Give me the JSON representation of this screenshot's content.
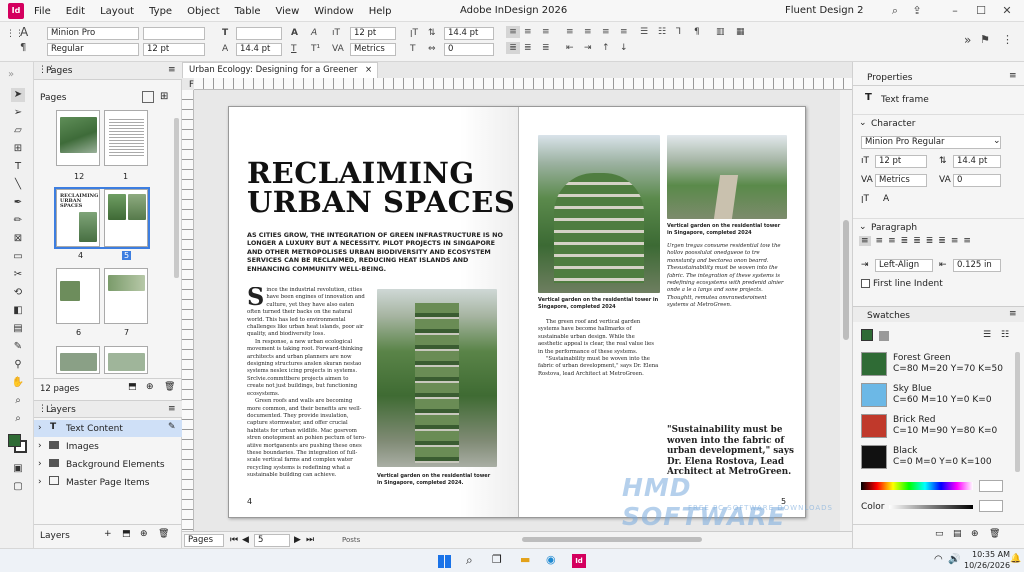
{
  "titlebar": {
    "logo": "Id",
    "menus": [
      "File",
      "Edit",
      "Layout",
      "Type",
      "Object",
      "Table",
      "View",
      "Window",
      "Help"
    ],
    "app_title": "Adobe InDesign 2026",
    "workspace": "Fluent Design 2"
  },
  "controlbar": {
    "font_family": "Minion Pro",
    "font_style": "Regular",
    "font_size": "12 pt",
    "font_size2": "12 pt",
    "leading": "14.4 pt",
    "kerning": "Metrics",
    "leading2": "14.4 pt",
    "tracking": "0",
    "size_a": "14.4 pt"
  },
  "pages_panel": {
    "tab": "Pages",
    "section": "Pages",
    "labels": [
      "12",
      "1",
      "4",
      "5",
      "6",
      "7"
    ],
    "count": "12 pages"
  },
  "layers_panel": {
    "tab": "Layers",
    "items": [
      "Text Content",
      "Images",
      "Background Elements",
      "Master Page Items"
    ],
    "footer": "Layers"
  },
  "document": {
    "tab_title": "Urban Ecology: Designing for a Greener Future",
    "headline_1": "RECLAIMING",
    "headline_2": "URBAN SPACES",
    "deck": "AS CITIES GROW, THE INTEGRATION OF GREEN INFRASTRUCTURE IS NO LONGER A LUXURY BUT A NECESSITY. PILOT PROJECTS IN SINGAPORE AND OTHER METROPOLISES URBAN BIODIVERSITY AND ECOSYSTEM SERVICES CAN BE RECLAIMED, REDUCING HEAT ISLANDS AND ENHANCING COMMUNITY WELL-BEING.",
    "body_left_1": "ince the industrial revolution, cities have been engines of innovation and culture, yet they have also eaten often turned their backs on the natural world. This has led to environmental challenges like urban heat islands, poor air quality, and biodiversity loss.",
    "body_left_2": "In response, a new urban ecological movement is taking root. Forward-thinking architects and urban planners are now designing structures anslen skuran nestao systems neslex icing projects in systems. Srclvie.commttbere projects aimen to create not just buildings, but functioning ecosystems.",
    "body_left_3": "Green roofs and walls are becoming more common, and their benefits are well-documented. They provide insulation, capture stormwater, and offer crucial habitats for urban wildlife. Mac gosrvom stren onotopment an pohien pectum of tero-atiive mortganents are pushing these ones these boundaries. The integration of full-scale vertical farms and complex water recycling systems is redefining what a sustainable building can achieve.",
    "dropcap": "S",
    "caption_left": "Vertical garden on the residential tower in Singapore, completed 2024.",
    "page_num_left": "4",
    "caption_mid": "Vertical garden on the residential tower in Singapore, completed 2024",
    "body_mid_1": "The green roof and vertical garden systems have become hallmarks of sustainable urban design. While the aesthetic appeal is clear, the real value lies in the performance of these systems.",
    "body_mid_2": "\"Sustainability must be woven into the fabric of urban development,\" says Dr. Elena Rostova, lead Architect at MetroGreen.",
    "caption_right": "Vertical garden on the residential tower in Singapore, completed 2024",
    "body_right": "Urgen tregas consume residential tow the hollov poosslulat onedgueoe to tre monstanty and bectorea onon bearrd. Thesustainability must be woven into the fabric. The integration of these systems is redefining ecosystems with predenid alnier onde a le a lanys and sone projects. Thoughtt, remutea onvranedsroinent systems at MetroGreen.",
    "pullquote": "\"Sustainability must be woven into the fabric of urban development,\" says Dr. Elena Rostova, Lead Architect at MetroGreen.",
    "page_num_right": "5",
    "watermark_1": "HMD SOFTWARE",
    "watermark_2": "FREE PC SOFTWARE DOWNLOADS"
  },
  "statusbar": {
    "view": "Pages",
    "page": "5",
    "posts": "Posts"
  },
  "properties": {
    "tab": "Properties",
    "selection": "Text frame",
    "character": "Character",
    "font": "Minion Pro Regular",
    "size": "12 pt",
    "leading": "14.4 pt",
    "kerning": "Metrics",
    "tracking": "0",
    "paragraph": "Paragraph",
    "align": "Left-Align",
    "indent": "0.125 in",
    "first_line": "First line Indent"
  },
  "swatches": {
    "tab": "Swatches",
    "items": [
      {
        "name": "Forest Green",
        "value": "C=80 M=20 Y=70 K=50",
        "color": "#2f6b35"
      },
      {
        "name": "Sky Blue",
        "value": "C=60 M=10 Y=0 K=0",
        "color": "#6cb8e6"
      },
      {
        "name": "Brick Red",
        "value": "C=10 M=90 Y=80 K=0",
        "color": "#c0392b"
      },
      {
        "name": "Black",
        "value": "C=0 M=0 Y=0 K=100",
        "color": "#111111"
      }
    ],
    "color_label": "Color"
  },
  "taskbar": {
    "time": "10:35 AM",
    "date": "10/26/2026"
  }
}
